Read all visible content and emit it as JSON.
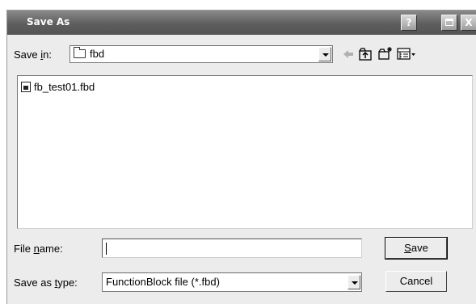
{
  "window": {
    "title": "Save As"
  },
  "titlebar_buttons": {
    "help": "?",
    "close": "X"
  },
  "save_in": {
    "label_pre": "Save ",
    "label_accel": "i",
    "label_post": "n:",
    "value": "fbd",
    "icon": "folder-icon"
  },
  "toolbar": [
    "back-arrow-icon",
    "up-folder-icon",
    "new-folder-icon",
    "view-menu-icon"
  ],
  "files": [
    {
      "name": "fb_test01.fbd",
      "icon": "fbd-file-icon"
    }
  ],
  "file_name": {
    "label_pre": "File ",
    "label_accel": "n",
    "label_post": "ame:",
    "value": ""
  },
  "save_as_type": {
    "label_pre": "Save as ",
    "label_accel": "t",
    "label_post": "ype:",
    "value": "FunctionBlock file (*.fbd)"
  },
  "buttons": {
    "save_accel": "S",
    "save_rest": "ave",
    "cancel": "Cancel"
  }
}
